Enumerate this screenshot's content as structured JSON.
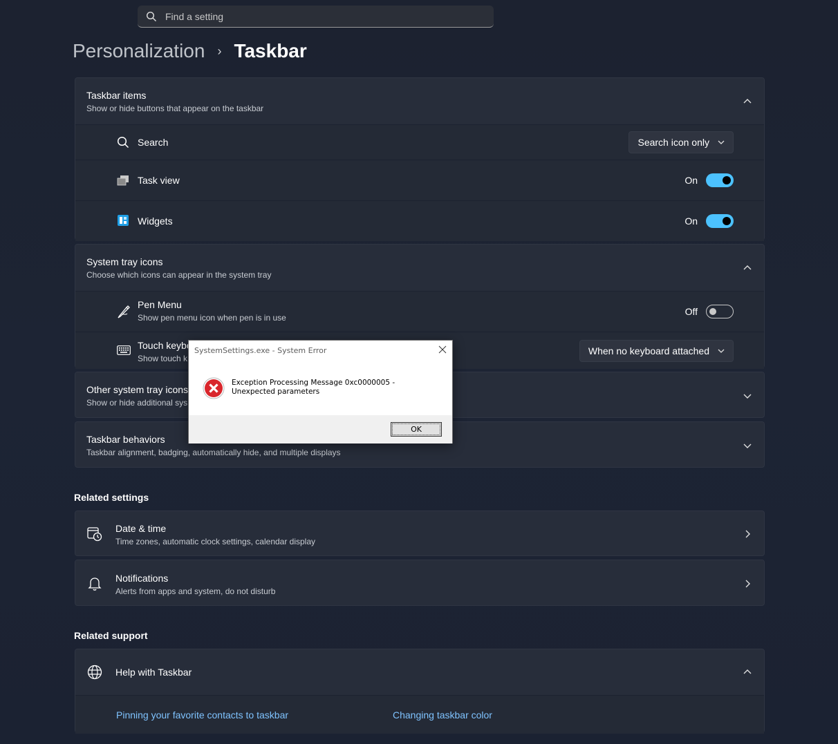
{
  "search": {
    "placeholder": "Find a setting",
    "icon": "search-icon"
  },
  "breadcrumb": {
    "parent": "Personalization",
    "separator": "›",
    "current": "Taskbar"
  },
  "taskbar_items": {
    "title": "Taskbar items",
    "description": "Show or hide buttons that appear on the taskbar",
    "items": [
      {
        "label": "Search",
        "control": "dropdown",
        "value": "Search icon only"
      },
      {
        "label": "Task view",
        "control": "toggle",
        "state": "On"
      },
      {
        "label": "Widgets",
        "control": "toggle",
        "state": "On"
      }
    ]
  },
  "system_tray": {
    "title": "System tray icons",
    "description": "Choose which icons can appear in the system tray",
    "items": [
      {
        "label": "Pen Menu",
        "description": "Show pen menu icon when pen is in use",
        "control": "toggle",
        "state": "Off"
      },
      {
        "label": "Touch keybo",
        "description": "Show touch k",
        "control": "dropdown",
        "value": "When no keyboard attached"
      }
    ]
  },
  "other_tray": {
    "title": "Other system tray icons",
    "description": "Show or hide additional sys"
  },
  "behaviors": {
    "title": "Taskbar behaviors",
    "description": "Taskbar alignment, badging, automatically hide, and multiple displays"
  },
  "related_settings": {
    "heading": "Related settings",
    "items": [
      {
        "title": "Date & time",
        "description": "Time zones, automatic clock settings, calendar display"
      },
      {
        "title": "Notifications",
        "description": "Alerts from apps and system, do not disturb"
      }
    ]
  },
  "related_support": {
    "heading": "Related support",
    "help_title": "Help with Taskbar",
    "links": [
      "Pinning your favorite contacts to taskbar",
      "Changing taskbar color"
    ]
  },
  "dialog": {
    "title": "SystemSettings.exe - System Error",
    "message": "Exception Processing Message 0xc0000005 - Unexpected parameters",
    "ok": "OK"
  },
  "colors": {
    "accent": "#4cc2ff",
    "link": "#7fc3ff",
    "card": "#272d3a",
    "error": "#d9262c"
  }
}
